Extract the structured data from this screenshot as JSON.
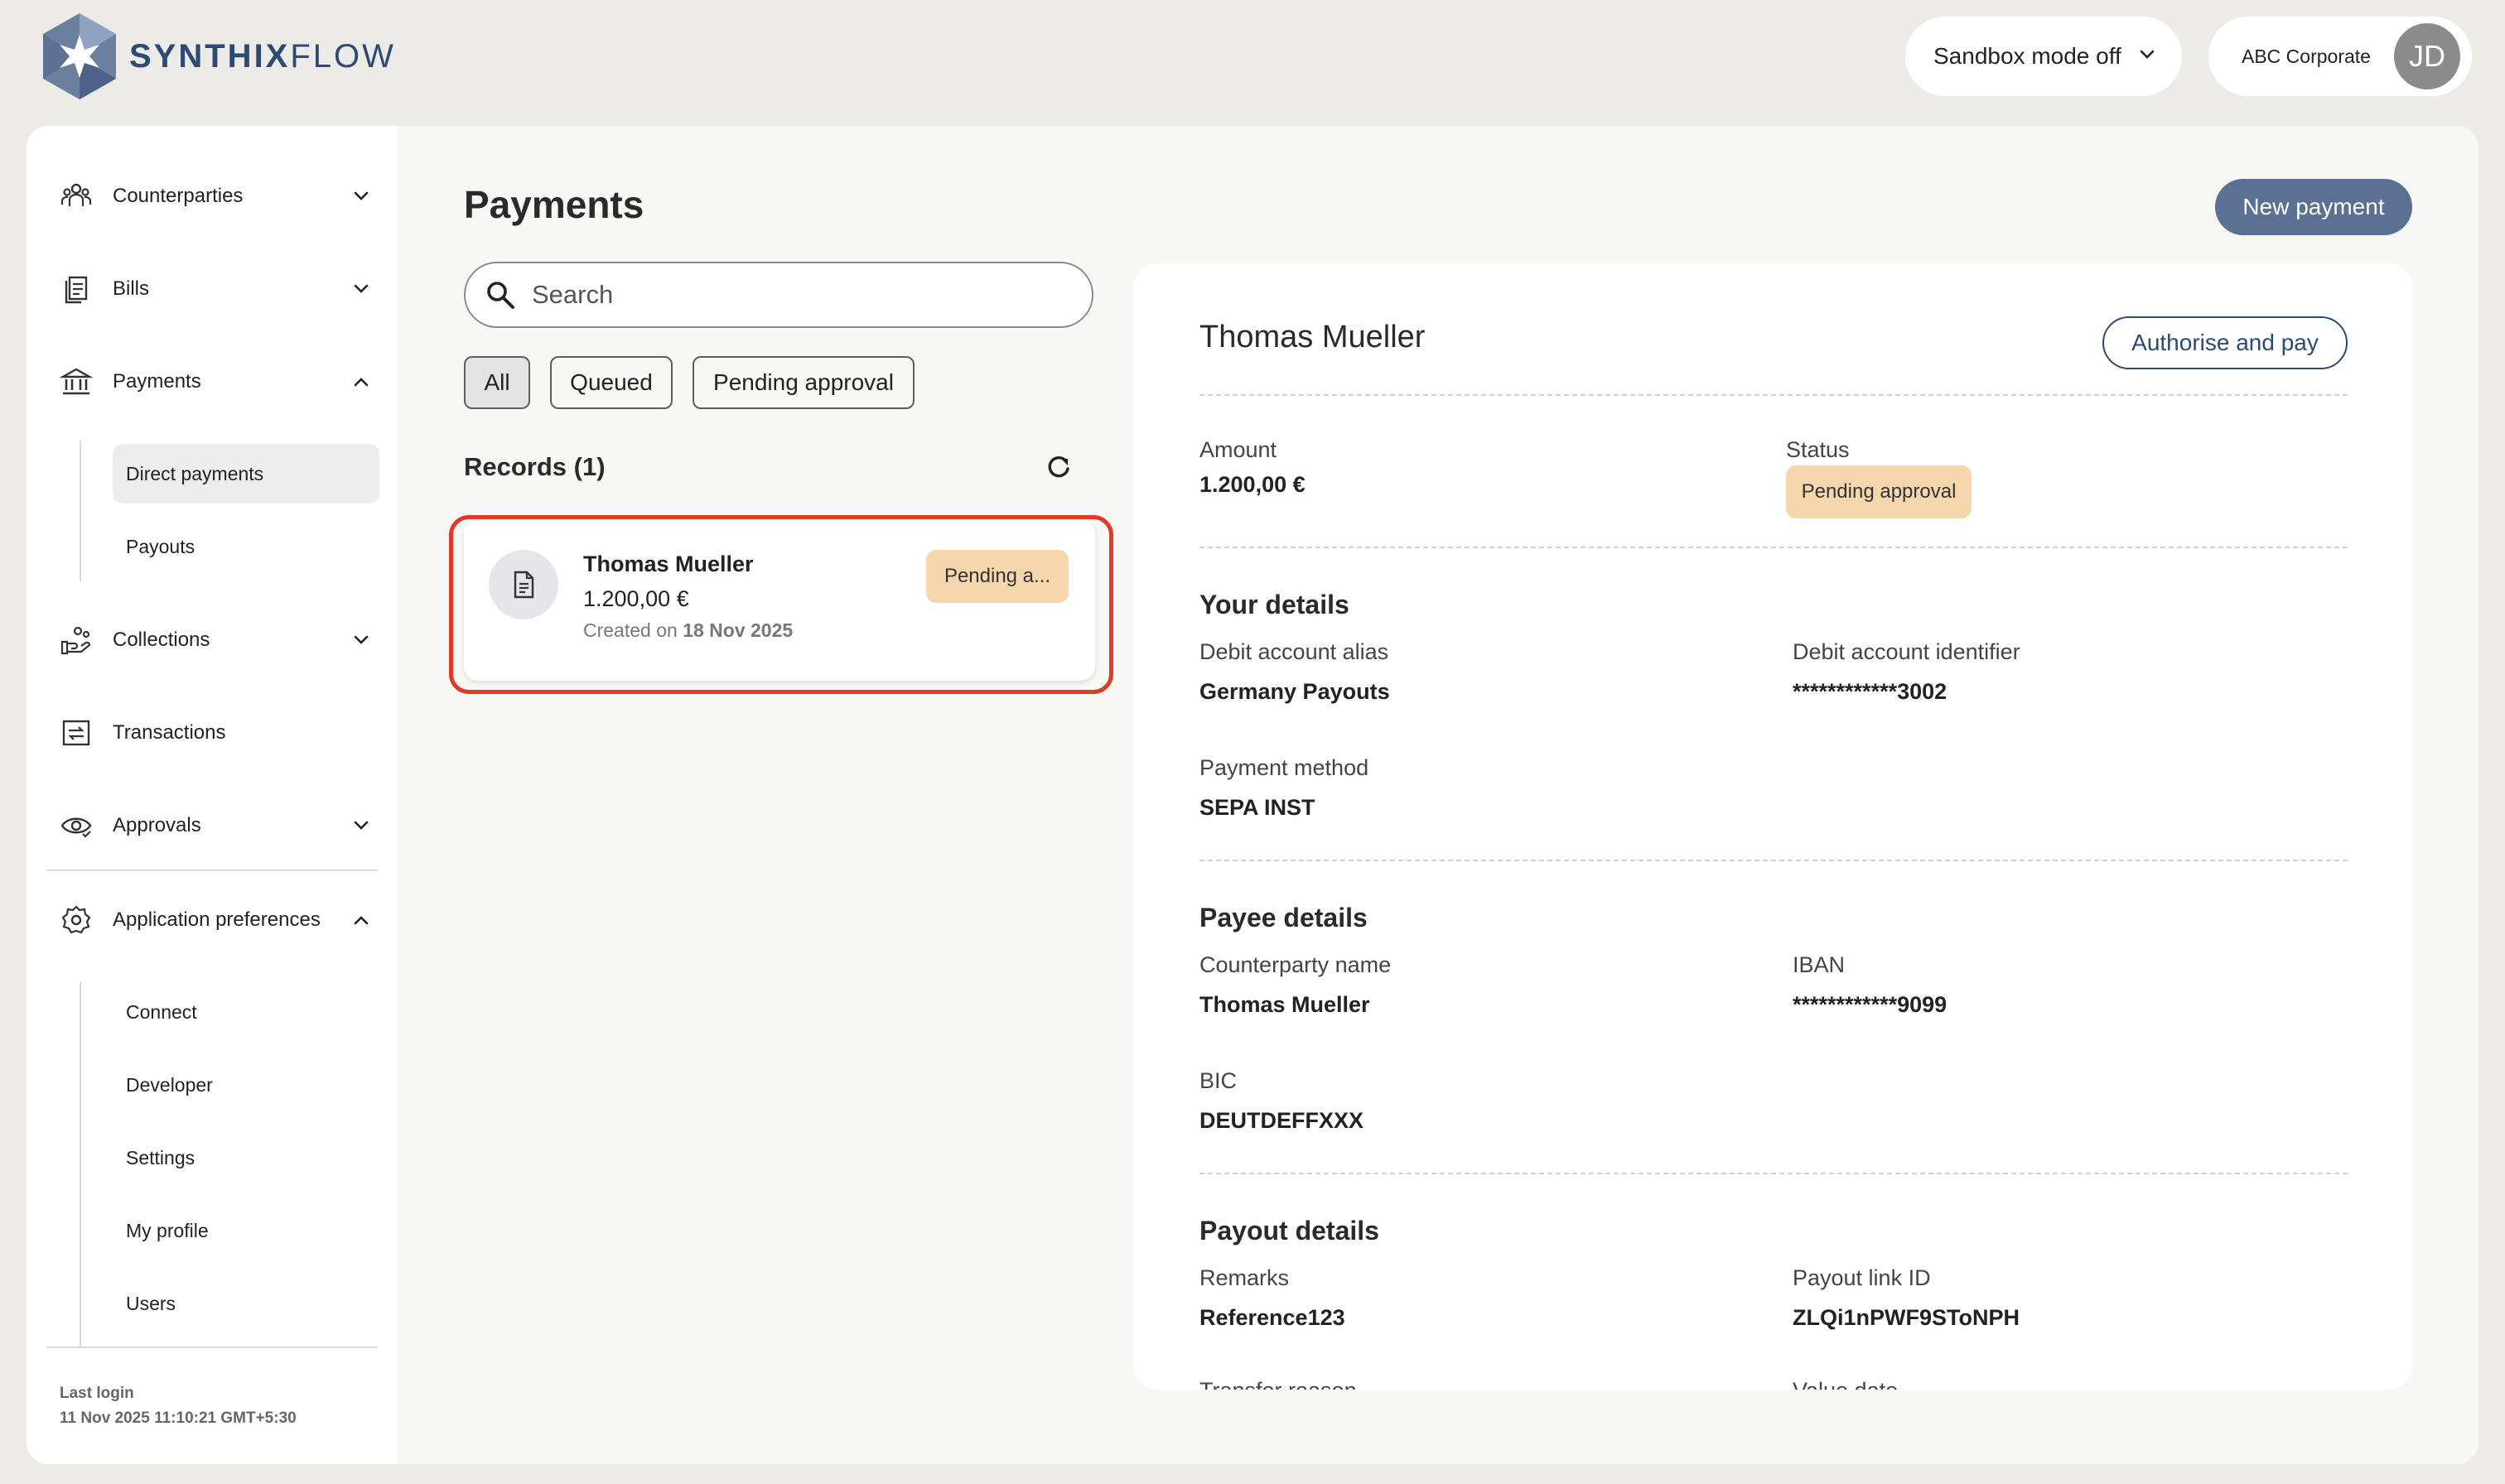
{
  "app": {
    "logo_bold": "SYNTHIX",
    "logo_light": "FLOW",
    "sandbox_label": "Sandbox mode off",
    "account_name": "ABC Corporate",
    "avatar_initials": "JD",
    "brand_color": "#2c4a74"
  },
  "sidebar": {
    "counterparties": "Counterparties",
    "bills": "Bills",
    "payments": "Payments",
    "direct_payments": "Direct payments",
    "payouts": "Payouts",
    "collections": "Collections",
    "transactions": "Transactions",
    "approvals": "Approvals",
    "app_prefs": "Application preferences",
    "connect": "Connect",
    "developer": "Developer",
    "settings": "Settings",
    "my_profile": "My profile",
    "users": "Users",
    "last_login_label": "Last login",
    "last_login_value": "11 Nov 2025 11:10:21 GMT+5:30"
  },
  "main": {
    "title": "Payments",
    "new_payment": "New payment",
    "search_placeholder": "Search",
    "filters": [
      "All",
      "Queued",
      "Pending approval"
    ],
    "records_title": "Records (1)",
    "record": {
      "name": "Thomas Mueller",
      "amount": "1.200,00 €",
      "created_prefix": "Created on",
      "created_date": "18 Nov 2025",
      "status": "Pending a..."
    }
  },
  "detail": {
    "title": "Thomas Mueller",
    "authorise": "Authorise and pay",
    "amount_label": "Amount",
    "amount_value": "1.200,00 €",
    "status_label": "Status",
    "status_value": "Pending approval",
    "your_details": "Your details",
    "debit_alias_label": "Debit account alias",
    "debit_alias_value": "Germany Payouts",
    "debit_id_label": "Debit account identifier",
    "debit_id_value": "************3002",
    "payment_method_label": "Payment method",
    "payment_method_value": "SEPA INST",
    "payee_details": "Payee details",
    "counterparty_label": "Counterparty name",
    "counterparty_value": "Thomas Mueller",
    "iban_label": "IBAN",
    "iban_value": "************9099",
    "bic_label": "BIC",
    "bic_value": "DEUTDEFFXXX",
    "payout_details": "Payout details",
    "remarks_label": "Remarks",
    "remarks_value": "Reference123",
    "payout_link_label": "Payout link ID",
    "payout_link_value": "ZLQi1nPWF9SToNPH",
    "transfer_label": "Transfer reason",
    "value_date_label": "Value date"
  }
}
